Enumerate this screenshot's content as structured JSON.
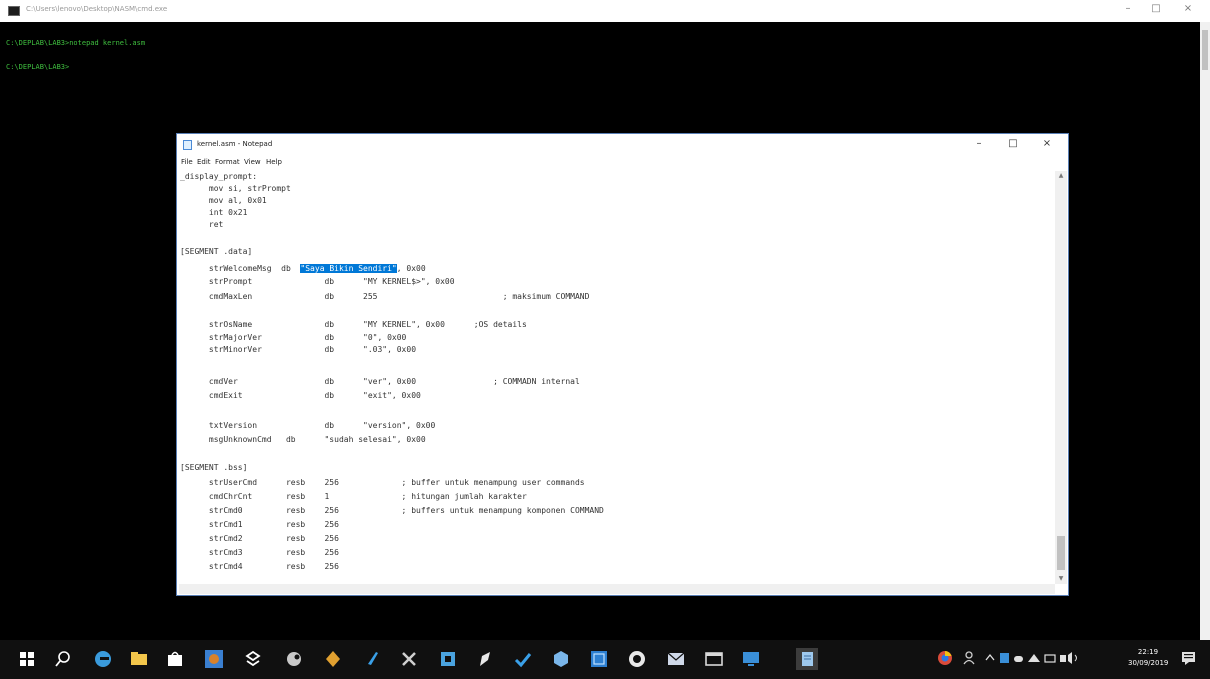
{
  "console": {
    "title": "C:\\Users\\lenovo\\Desktop\\NASM\\cmd.exe",
    "lines": [
      "C:\\DEPLAB\\LAB3>notepad kernel.asm",
      "C:\\DEPLAB\\LAB3>"
    ]
  },
  "notepad": {
    "title": "kernel.asm - Notepad",
    "menu": [
      "File",
      "Edit",
      "Format",
      "View",
      "Help"
    ],
    "lines": [
      {
        "t": "_display_prompt:"
      },
      {
        "t": "      mov si, strPrompt"
      },
      {
        "t": "      mov al, 0x01"
      },
      {
        "t": "      int 0x21"
      },
      {
        "t": "      ret"
      },
      {
        "t": ""
      },
      {
        "t": "[SEGMENT .data]"
      },
      {
        "pre": "      strWelcomeMsg  db  ",
        "hl": "\"Saya Bikin Sendiri\"",
        "post": ", 0x00"
      },
      {
        "t": "      strPrompt               db      \"MY KERNEL$>\", 0x00"
      },
      {
        "t": "      cmdMaxLen               db      255                          ; maksimum COMMAND"
      },
      {
        "t": ""
      },
      {
        "t": "      strOsName               db      \"MY KERNEL\", 0x00      ;OS details"
      },
      {
        "t": "      strMajorVer             db      \"0\", 0x00"
      },
      {
        "t": "      strMinorVer             db      \".03\", 0x00"
      },
      {
        "t": ""
      },
      {
        "t": "      cmdVer                  db      \"ver\", 0x00                ; COMMADN internal"
      },
      {
        "t": "      cmdExit                 db      \"exit\", 0x00"
      },
      {
        "t": ""
      },
      {
        "t": "      txtVersion              db      \"version\", 0x00"
      },
      {
        "t": "      msgUnknownCmd   db      \"sudah selesai\", 0x00"
      },
      {
        "t": ""
      },
      {
        "t": "[SEGMENT .bss]"
      },
      {
        "t": "      strUserCmd      resb    256             ; buffer untuk menampung user commands"
      },
      {
        "t": "      cmdChrCnt       resb    1               ; hitungan jumlah karakter"
      },
      {
        "t": "      strCmd0         resb    256             ; buffers untuk menampung komponen COMMAND"
      },
      {
        "t": "      strCmd1         resb    256"
      },
      {
        "t": "      strCmd2         resb    256"
      },
      {
        "t": "      strCmd3         resb    256"
      },
      {
        "t": "      strCmd4         resb    256"
      }
    ]
  },
  "clock": {
    "time": "22:19",
    "date": "30/09/2019"
  },
  "colors": {
    "console_text": "#3fbf3f",
    "selection": "#0078d7",
    "taskbar": "#101010"
  },
  "taskbar_icons": [
    {
      "name": "start-icon",
      "color": "#ffffff"
    },
    {
      "name": "search-icon",
      "color": "#ffffff"
    },
    {
      "name": "edge-icon",
      "color": "#3a9bdc"
    },
    {
      "name": "folder-icon",
      "color": "#f3c64b"
    },
    {
      "name": "store-icon",
      "color": "#ffffff"
    },
    {
      "name": "photos-icon",
      "color": "#d9822b"
    },
    {
      "name": "dropbox-icon",
      "color": "#ffffff"
    },
    {
      "name": "steam-icon",
      "color": "#c8c8c8"
    },
    {
      "name": "app-icon",
      "color": "#e0a030"
    },
    {
      "name": "vscode-icon",
      "color": "#3aa0e8"
    },
    {
      "name": "tool-icon",
      "color": "#cfcfcf"
    },
    {
      "name": "app2-icon",
      "color": "#4aa3df"
    },
    {
      "name": "pen-icon",
      "color": "#e8e8e8"
    },
    {
      "name": "check-icon",
      "color": "#3aa0e8"
    },
    {
      "name": "cube-icon",
      "color": "#7ab6ea"
    },
    {
      "name": "pr-icon",
      "color": "#2d7fd0"
    },
    {
      "name": "whatsapp-icon",
      "color": "#e8e8e8"
    },
    {
      "name": "mail-icon",
      "color": "#cfd8e8"
    },
    {
      "name": "window-icon",
      "color": "#d8d8d8"
    },
    {
      "name": "network-icon",
      "color": "#3a8fd8"
    },
    {
      "name": "notepad-taskbar-icon",
      "color": "#9ec9ee"
    }
  ]
}
